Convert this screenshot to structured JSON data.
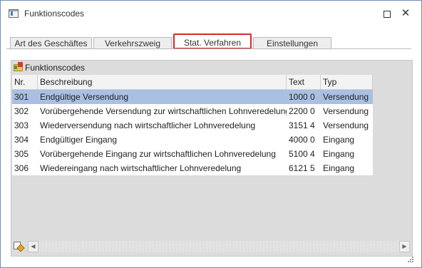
{
  "window": {
    "title": "Funktionscodes",
    "maximize_icon": "maximize-icon",
    "close_label": "✕"
  },
  "tabs": [
    {
      "label": "Art des Geschäftes",
      "active": false
    },
    {
      "label": "Verkehrszweig",
      "active": false
    },
    {
      "label": "Stat. Verfahren",
      "active": true
    },
    {
      "label": "Einstellungen",
      "active": false
    }
  ],
  "panel": {
    "title": "Funktionscodes",
    "icon": "folder-icon"
  },
  "table": {
    "columns": [
      "Nr.",
      "Beschreibung",
      "Text",
      "Typ"
    ],
    "rows": [
      {
        "nr": "301",
        "beschreibung": "Endgültige Versendung",
        "text": "1000 0",
        "typ": "Versendung",
        "selected": true
      },
      {
        "nr": "302",
        "beschreibung": "Vorübergehende Versendung zur wirtschaftlichen Lohnveredelung",
        "text": "2200 0",
        "typ": "Versendung",
        "selected": false
      },
      {
        "nr": "303",
        "beschreibung": "Wiederversendung nach wirtschaftlicher Lohnveredelung",
        "text": "3151 4",
        "typ": "Versendung",
        "selected": false
      },
      {
        "nr": "304",
        "beschreibung": "Endgültiger Eingang",
        "text": "4000 0",
        "typ": "Eingang",
        "selected": false
      },
      {
        "nr": "305",
        "beschreibung": "Vorübergehende Eingang zur wirtschaftlichen Lohnveredelung",
        "text": "5100 4",
        "typ": "Eingang",
        "selected": false
      },
      {
        "nr": "306",
        "beschreibung": "Wiedereingang nach wirtschaftlicher Lohnveredelung",
        "text": "6121 5",
        "typ": "Eingang",
        "selected": false
      }
    ]
  },
  "scrollbar": {
    "left_arrow": "◀",
    "right_arrow": "▶"
  },
  "colors": {
    "selected_row": "#a9c0e3",
    "active_tab_highlight": "#d42a2a",
    "panel_background": "#dcdcdc"
  }
}
